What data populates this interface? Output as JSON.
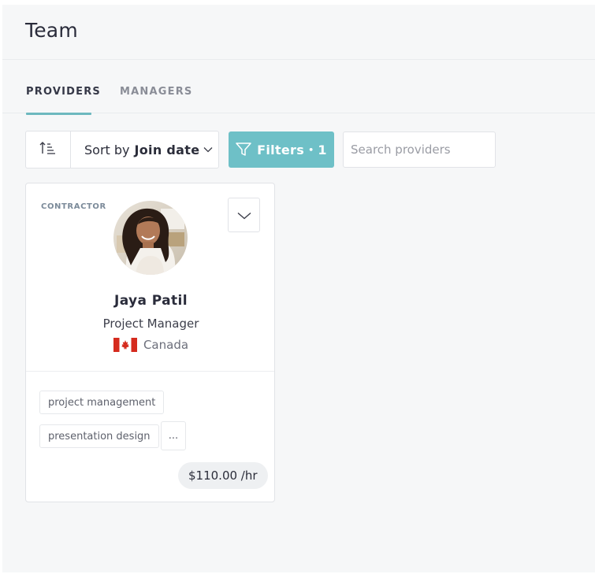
{
  "header": {
    "title": "Team"
  },
  "tabs": [
    {
      "label": "PROVIDERS",
      "active": true
    },
    {
      "label": "MANAGERS",
      "active": false
    }
  ],
  "toolbar": {
    "sort_prefix": "Sort by",
    "sort_value": "Join date",
    "filters_label": "Filters",
    "filters_separator": "•",
    "filters_count": "1",
    "search_placeholder": "Search providers"
  },
  "providers": [
    {
      "type": "CONTRACTOR",
      "name": "Jaya Patil",
      "role": "Project Manager",
      "country": "Canada",
      "skills": [
        "project management",
        "presentation design"
      ],
      "more_label": "...",
      "rate": "$110.00 /hr"
    }
  ],
  "colors": {
    "accent": "#6ec0c7",
    "tab_underline": "#6db8bf",
    "background": "#f6f7f8",
    "flag_red": "#d52b1e"
  },
  "icons": [
    "sort-direction-icon",
    "chevron-down-icon",
    "filter-icon",
    "search-icon",
    "canada-flag-icon"
  ]
}
